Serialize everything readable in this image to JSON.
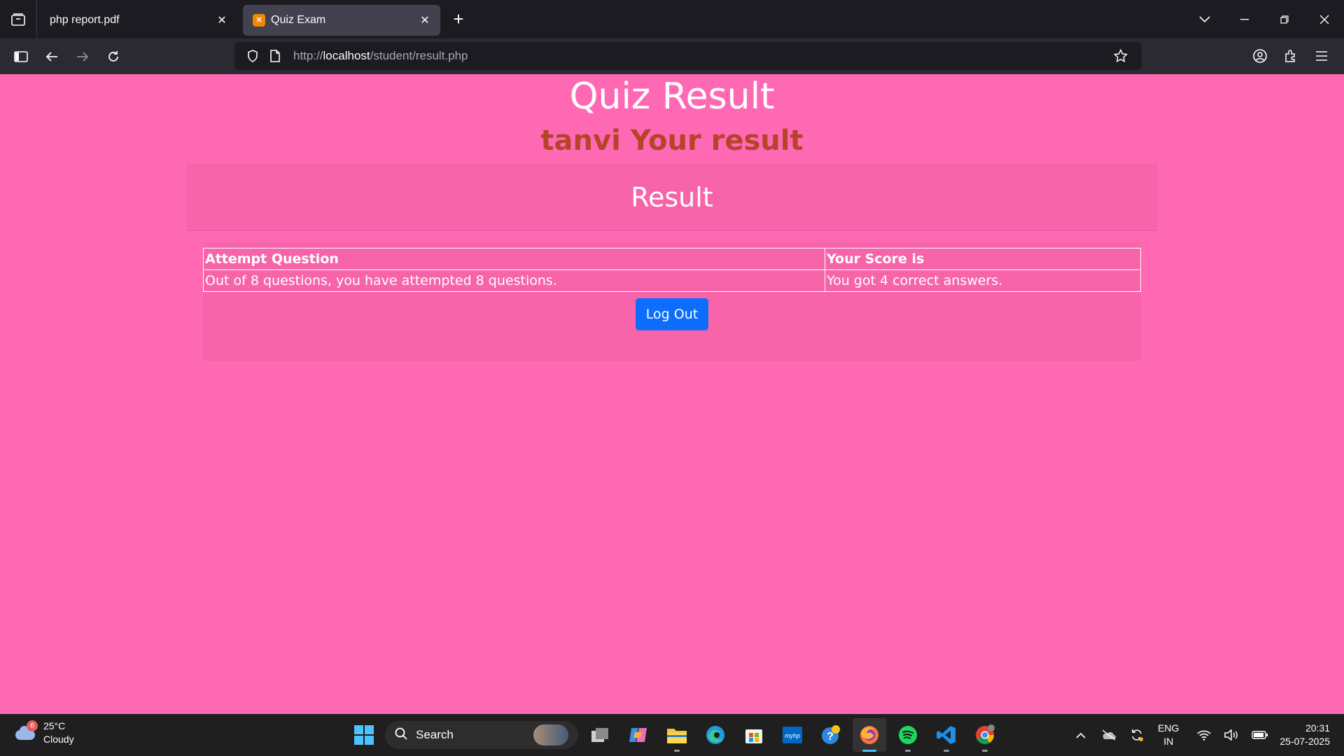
{
  "browser": {
    "tabs": [
      {
        "title": "php report.pdf",
        "active": false
      },
      {
        "title": "Quiz Exam",
        "active": true
      }
    ],
    "url": {
      "scheme": "http://",
      "host": "localhost",
      "path": "/student/result.php"
    }
  },
  "page": {
    "title": "Quiz Result",
    "subtitle": "tanvi Your result",
    "card_header": "Result",
    "table": {
      "headers": [
        "Attempt Question",
        "Your Score is"
      ],
      "rows": [
        [
          "Out of 8 questions, you have attempted 8 questions.",
          "You got 4 correct answers."
        ]
      ]
    },
    "logout_label": "Log Out",
    "colors": {
      "background": "#ff69b4",
      "card": "#f764a9",
      "subtitle": "#b5442b",
      "button": "#0d6efd"
    }
  },
  "taskbar": {
    "weather": {
      "temp": "25°C",
      "condition": "Cloudy",
      "badge": "6"
    },
    "search_label": "Search",
    "apps": [
      "task-view",
      "copilot",
      "file-explorer",
      "edge",
      "microsoft-store",
      "myhp",
      "help",
      "firefox",
      "spotify",
      "vscode",
      "chrome"
    ],
    "tray": {
      "lang_line1": "ENG",
      "lang_line2": "IN",
      "time": "20:31",
      "date": "25-07-2025"
    }
  }
}
